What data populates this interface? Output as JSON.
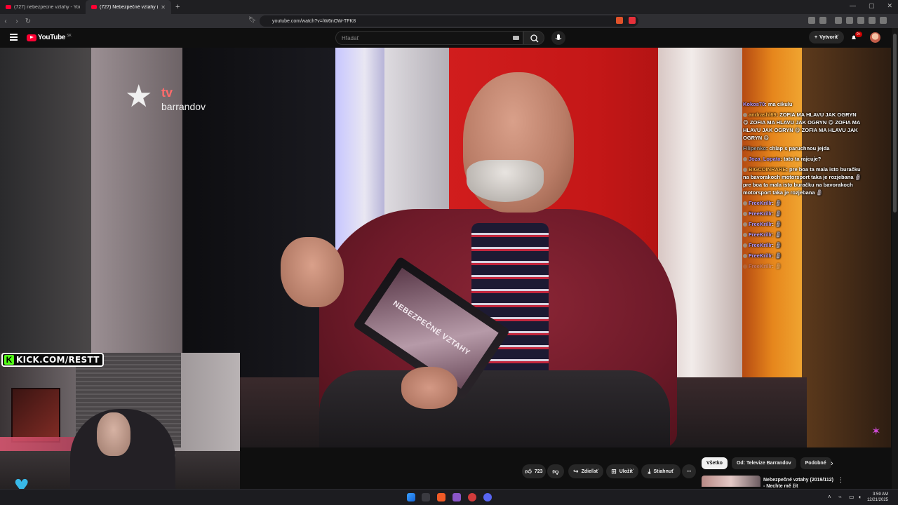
{
  "browser": {
    "tabs": [
      {
        "label": "(727) nebezpecne vztahy - YouTube",
        "active": false
      },
      {
        "label": "(727) Nebezpečné vztahy (20",
        "active": true
      }
    ],
    "url": "youtube.com/watch?v=iW6nOW-TFK8",
    "window_controls": [
      "—",
      "▢",
      "✕"
    ]
  },
  "youtube": {
    "logo_text": "YouTube",
    "region": "SK",
    "search_placeholder": "Hľadať",
    "create_label": "Vytvoriť",
    "notifications_badge": "9+"
  },
  "video": {
    "channel_logo_tv": "tv",
    "channel_logo_name": "barrandov",
    "tablet_text": "NEBEZPEČNÉ VZTAHY"
  },
  "stream_overlay": {
    "kick_text": "KICK.COM/RESTT",
    "chat": [
      {
        "user": "Kokos70",
        "text": "ma cikulu"
      },
      {
        "user": "andrashl69",
        "text": "ZOFIA MA HLAVU JAK OGRYN 😋 ZOFIA MA HLAVU JAK OGRYN 😋 ZOFIA MA HLAVU JAK OGRYN 😋 ZOFIA MA HLAVU JAK OGRYN 😋"
      },
      {
        "user": "Filipenko",
        "text": "chlap s paruchnou jejda"
      },
      {
        "user": "Joza_Lopata",
        "text": "tato ta rajcuje?"
      },
      {
        "user": "BIGCOINRARE",
        "text": "pre boa ta mala isto buračku na bavorakoch motorsport taka je rozjebana 🗿 pre boa ta mala isto buračku na bavorakoch motorsport taka je rozjebana 🗿"
      },
      {
        "user": "FreeKrillr",
        "text": "🗿"
      },
      {
        "user": "FreeKrillr",
        "text": "🗿"
      },
      {
        "user": "FreeKrillr",
        "text": "🗿"
      },
      {
        "user": "FreeKrillr",
        "text": "🗿"
      },
      {
        "user": "FreeKrillr",
        "text": "🗿"
      },
      {
        "user": "FreeKrillr",
        "text": "🗿"
      },
      {
        "user": "FreeKrillr",
        "text": "🗿"
      }
    ]
  },
  "actions": {
    "like_count": "723",
    "share_label": "Zdieľať",
    "save_label": "Uložiť",
    "download_label": "Stiahnuť",
    "more_label": "⋯"
  },
  "recommendations": {
    "chips": [
      "Všetko",
      "Od: Televize Barrandov",
      "Podobné"
    ],
    "first_title_line1": "Nebezpečné vztahy (2019/112)",
    "first_title_line2": "- Nechte mě žít"
  },
  "taskbar": {
    "time": "3:59 AM",
    "date": "12/21/2025"
  },
  "colors": {
    "youtube_red": "#ff0033",
    "kick_green": "#53fc18",
    "chat_user": "#b197fc"
  }
}
